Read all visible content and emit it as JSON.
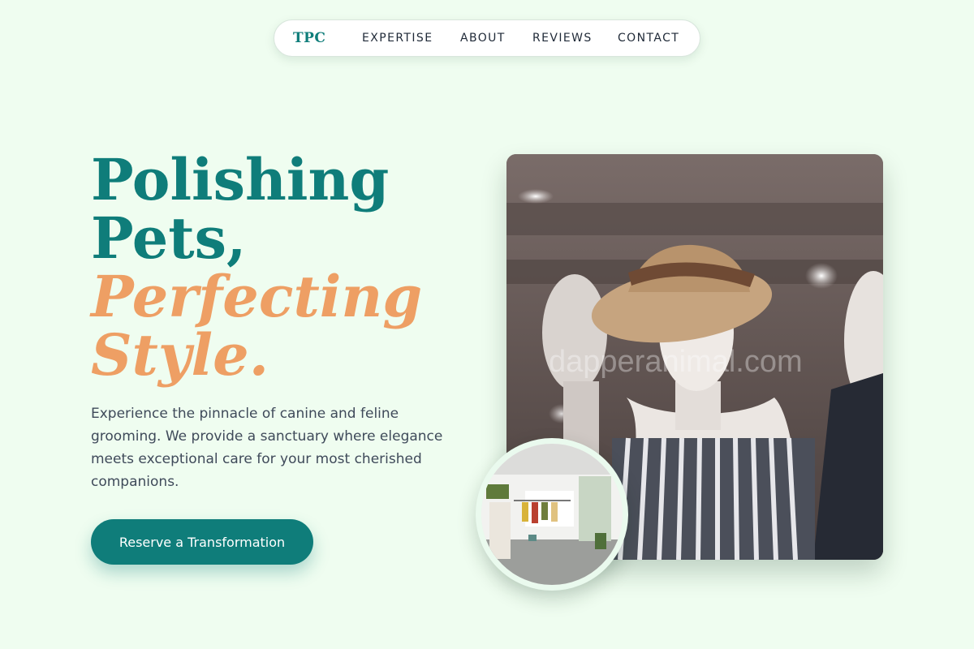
{
  "nav": {
    "logo": "TPC",
    "links": [
      "EXPERTISE",
      "ABOUT",
      "REVIEWS",
      "CONTACT"
    ]
  },
  "hero": {
    "title_line1": "Polishing",
    "title_line2": "Pets,",
    "title_line3": "Perfecting",
    "title_line4": "Style.",
    "description": "Experience the pinnacle of canine and feline grooming. We provide a sanctuary where elegance meets exceptional care for your most cherished companions.",
    "cta": "Reserve a Transformation"
  },
  "media": {
    "main_photo_icon": "mannequin-hat-photo",
    "watermark": "dapperanimal.com",
    "inset_photo_icon": "boutique-interior-photo"
  },
  "colors": {
    "background": "#effdf0",
    "accent_teal": "#0f7d7a",
    "accent_orange": "#ee9f64"
  }
}
